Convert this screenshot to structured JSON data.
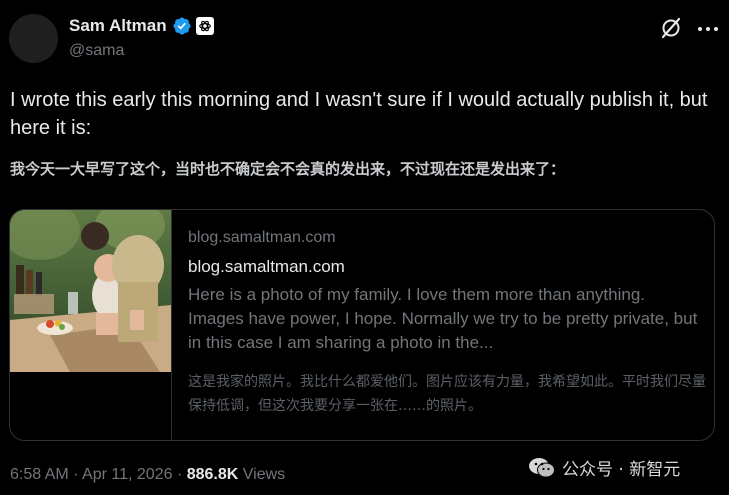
{
  "author": {
    "name": "Sam Altman",
    "handle": "@sama"
  },
  "tweet": {
    "text_en": "I wrote this early this morning and I wasn't sure if I would actually publish it, but here it is:",
    "text_cn": "我今天一大早写了这个，当时也不确定会不会真的发出来，不过现在还是发出来了："
  },
  "card": {
    "domain": "blog.samaltman.com",
    "title": "blog.samaltman.com",
    "description": "Here is a photo of my family. I love them more than anything. Images have power, I hope. Normally we try to be pretty private, but in this case I am sharing a photo in the...",
    "description_cn": "这是我家的照片。我比什么都爱他们。图片应该有力量，我希望如此。平时我们尽量保持低调，但这次我要分享一张在……的照片。"
  },
  "meta": {
    "time": "6:58 AM",
    "sep1": "·",
    "date": "Apr 11, 2026",
    "sep2": "·",
    "views_count": "886.8K",
    "views_label": "Views"
  },
  "watermark": {
    "text": "公众号 · 新智元"
  },
  "icons": {
    "verified": "verified-badge-icon",
    "affiliation": "openai-logo-icon",
    "grok": "grok-icon",
    "more": "more-options-icon",
    "wechat": "wechat-icon"
  },
  "colors": {
    "background": "#000000",
    "text_primary": "#e7e9ea",
    "text_secondary": "#71767b",
    "verified_blue": "#1d9bf0",
    "border": "#2f3336"
  }
}
